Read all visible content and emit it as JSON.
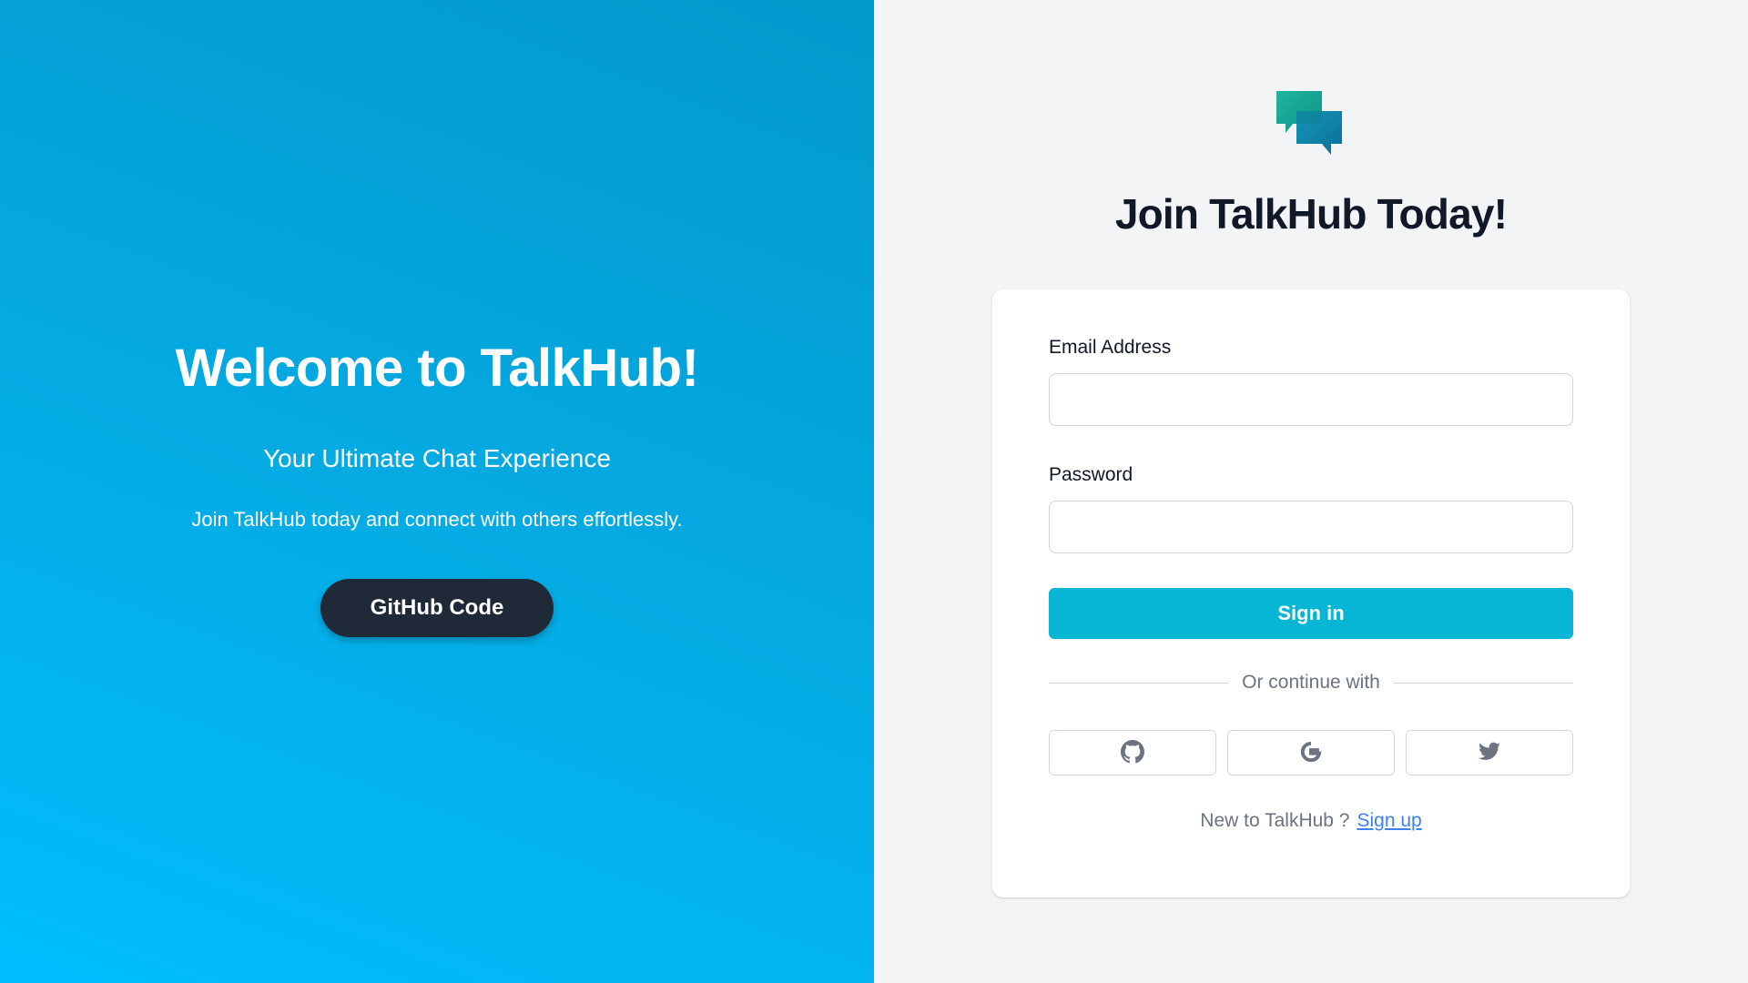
{
  "hero": {
    "title": "Welcome to TalkHub!",
    "subtitle": "Your Ultimate Chat Experience",
    "text": "Join TalkHub today and connect with others effortlessly.",
    "github_button_label": "GitHub Code"
  },
  "auth": {
    "logo_icon": "chat-bubbles-icon",
    "title": "Join TalkHub Today!",
    "email_label": "Email Address",
    "email_value": "",
    "password_label": "Password",
    "password_value": "",
    "signin_label": "Sign in",
    "divider_text": "Or continue with",
    "social_buttons": [
      {
        "icon": "github-icon"
      },
      {
        "icon": "google-icon"
      },
      {
        "icon": "twitter-icon"
      }
    ],
    "signup_prompt": "New to TalkHub ?",
    "signup_link": "Sign up"
  },
  "colors": {
    "hero_gradient_start": "#0299cc",
    "hero_gradient_end": "#00bdfd",
    "accent": "#06b6d4",
    "dark_button": "#1f2937",
    "link": "#3b82f6",
    "background": "#f3f4f6"
  }
}
